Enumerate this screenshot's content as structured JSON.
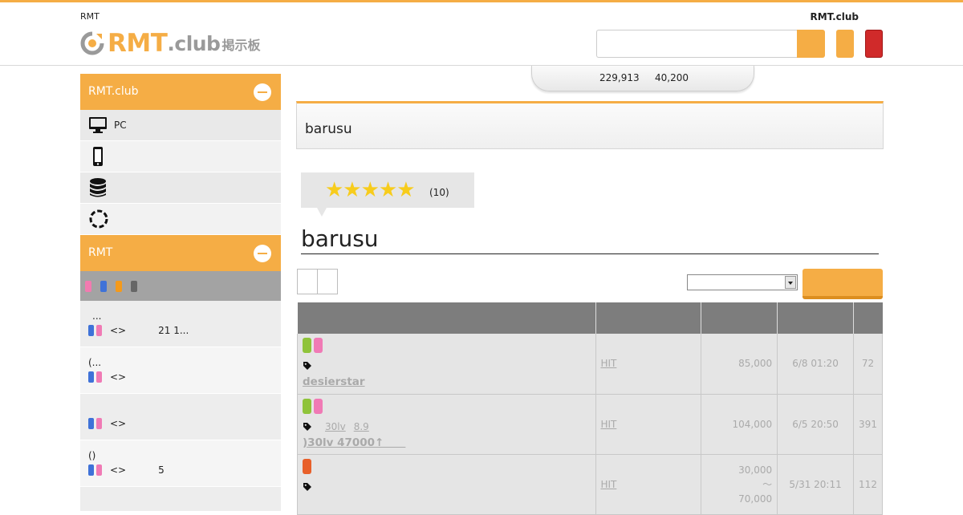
{
  "header": {
    "tagline": "RMT",
    "logo_main": "RMT",
    "logo_club": ".club",
    "logo_bbs": "掲示板",
    "site_name": "RMT.club",
    "stats": [
      "229,913",
      "40,200"
    ]
  },
  "sidebar": {
    "section1_title": "RMT.club",
    "items": [
      {
        "icon": "monitor-icon",
        "label": "PC"
      },
      {
        "icon": "smartphone-icon",
        "label": ""
      },
      {
        "icon": "coins-icon",
        "label": ""
      },
      {
        "icon": "dotted-circle-icon",
        "label": ""
      }
    ],
    "section2_title": "RMT",
    "chip_colors": [
      "#f27ab0",
      "#3f72d8",
      "#f59a1a",
      "#666666"
    ],
    "posts": [
      {
        "line1": "...",
        "arrows": "<>",
        "extra": "21 1..."
      },
      {
        "line1": "(...",
        "arrows": "<>",
        "extra": ""
      },
      {
        "line1": "",
        "arrows": "<>",
        "extra": ""
      },
      {
        "line1": "()",
        "arrows": "<>",
        "extra": "5"
      }
    ]
  },
  "main": {
    "page_title": "barusu",
    "rating": {
      "stars": "★★★★★",
      "count": "(10)"
    },
    "user_heading": "barusu",
    "table": {
      "rows": [
        {
          "chips": [
            "#8fc33a",
            "#f07ab5"
          ],
          "tag_links": [],
          "title": "desierstar",
          "hit": "HIT",
          "price": "85,000",
          "date": "6/8 01:20",
          "views": "72"
        },
        {
          "chips": [
            "#8fc33a",
            "#f07ab5"
          ],
          "tag_links": [
            "30lv",
            "8.9"
          ],
          "title": ")30lv 47000↑　　",
          "hit": "HIT",
          "price": "104,000",
          "date": "6/5 20:50",
          "views": "391"
        },
        {
          "chips": [
            "#e8602a"
          ],
          "tag_links": [],
          "title": "",
          "hit": "HIT",
          "price_low": "30,000",
          "price_sep": "～",
          "price_high": "70,000",
          "date": "5/31 20:11",
          "views": "112"
        }
      ]
    }
  }
}
